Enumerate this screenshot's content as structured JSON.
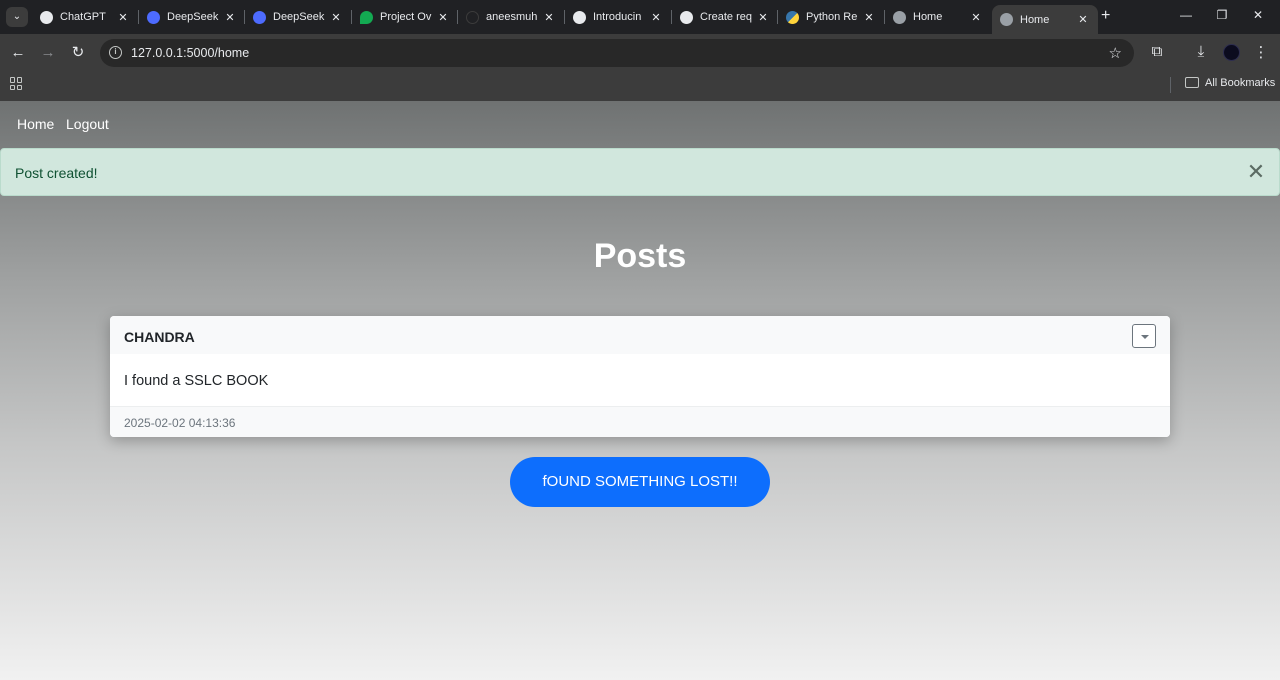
{
  "browser": {
    "tabs": [
      {
        "label": "ChatGPT",
        "favicon": "openai-icon",
        "active": false
      },
      {
        "label": "DeepSeek",
        "favicon": "deepseek-icon",
        "active": false
      },
      {
        "label": "DeepSeek",
        "favicon": "deepseek-icon",
        "active": false
      },
      {
        "label": "Project Ov",
        "favicon": "leaf-icon",
        "active": false
      },
      {
        "label": "aneesmuh",
        "favicon": "github-icon",
        "active": false
      },
      {
        "label": "Introducin",
        "favicon": "openai-icon",
        "active": false
      },
      {
        "label": "Create req",
        "favicon": "openai-icon",
        "active": false
      },
      {
        "label": "Python Re",
        "favicon": "python-icon",
        "active": false
      },
      {
        "label": "Home",
        "favicon": "globe-icon",
        "active": false
      },
      {
        "label": "Home",
        "favicon": "globe-icon",
        "active": true
      }
    ],
    "tab_close_glyph": "✕",
    "new_tab_glyph": "+",
    "url": "127.0.0.1:5000/home",
    "bookmarks_label": "All Bookmarks",
    "colors": {
      "chrome_dark": "#202124",
      "chrome_toolbar": "#3c3c3c"
    }
  },
  "site": {
    "nav": {
      "home": "Home",
      "logout": "Logout"
    },
    "alert": {
      "message": "Post created!",
      "close_glyph": "✕"
    },
    "title": "Posts",
    "posts": [
      {
        "author": "CHANDRA",
        "text": "I found a SSLC BOOK",
        "timestamp": "2025-02-02 04:13:36"
      }
    ],
    "cta_label": "fOUND SOMETHING LOST!!",
    "colors": {
      "primary": "#0d6efd",
      "alert_bg": "#d1e7dd",
      "alert_text": "#0f5132"
    }
  }
}
